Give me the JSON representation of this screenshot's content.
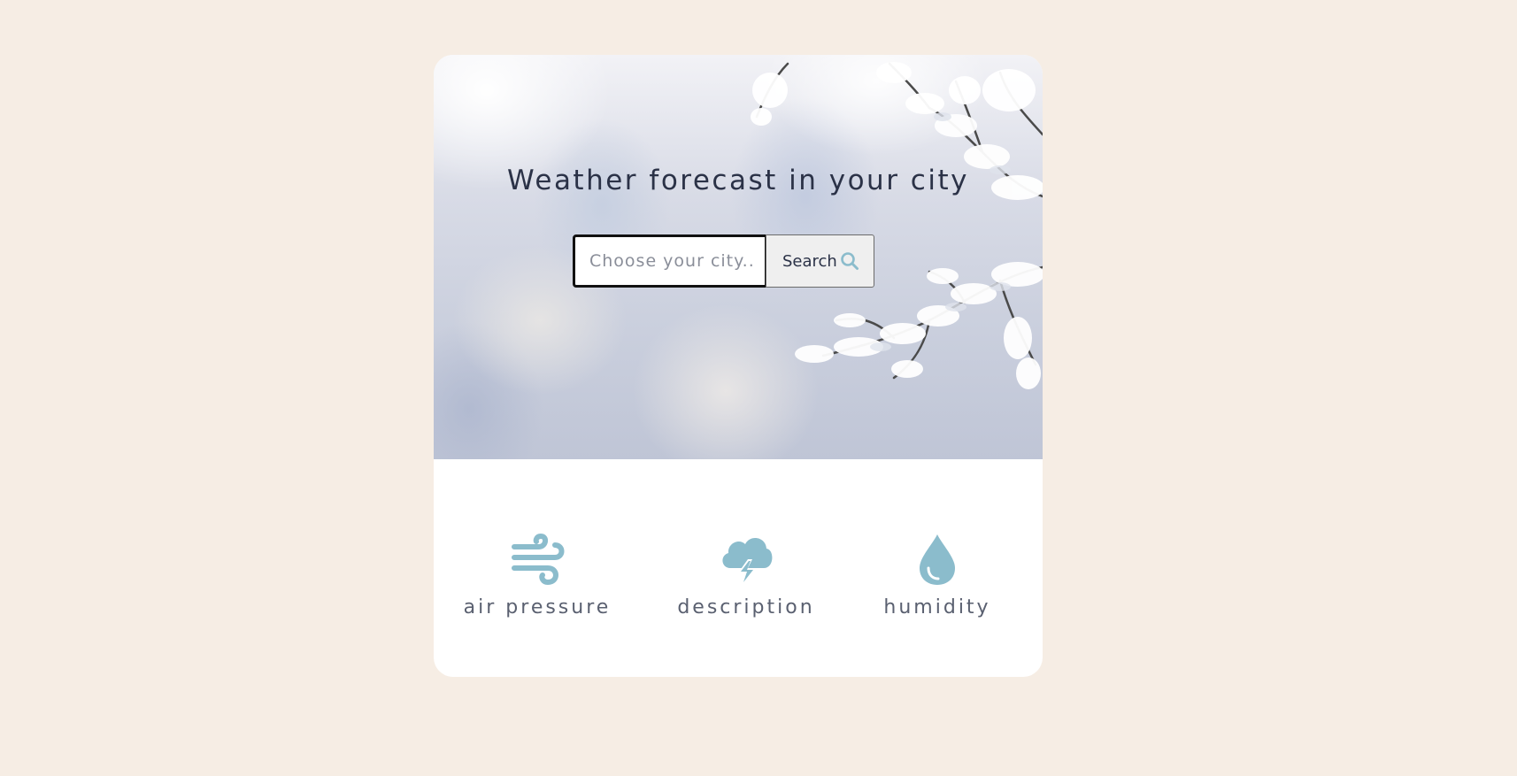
{
  "hero": {
    "title": "Weather forecast in your city",
    "background": "snowy-branches-photo"
  },
  "search": {
    "placeholder": "Choose your city.....",
    "value": "",
    "button_label": "Search",
    "button_icon": "search-icon"
  },
  "stats": [
    {
      "label": "air pressure",
      "icon": "wind-icon"
    },
    {
      "label": "description",
      "icon": "cloud-lightning-icon"
    },
    {
      "label": "humidity",
      "icon": "water-drop-icon"
    }
  ],
  "colors": {
    "page_background": "#f6ede4",
    "card_background": "#ffffff",
    "accent": "#8bbccc",
    "title_text": "#2b3247",
    "label_text": "#5a6070"
  }
}
